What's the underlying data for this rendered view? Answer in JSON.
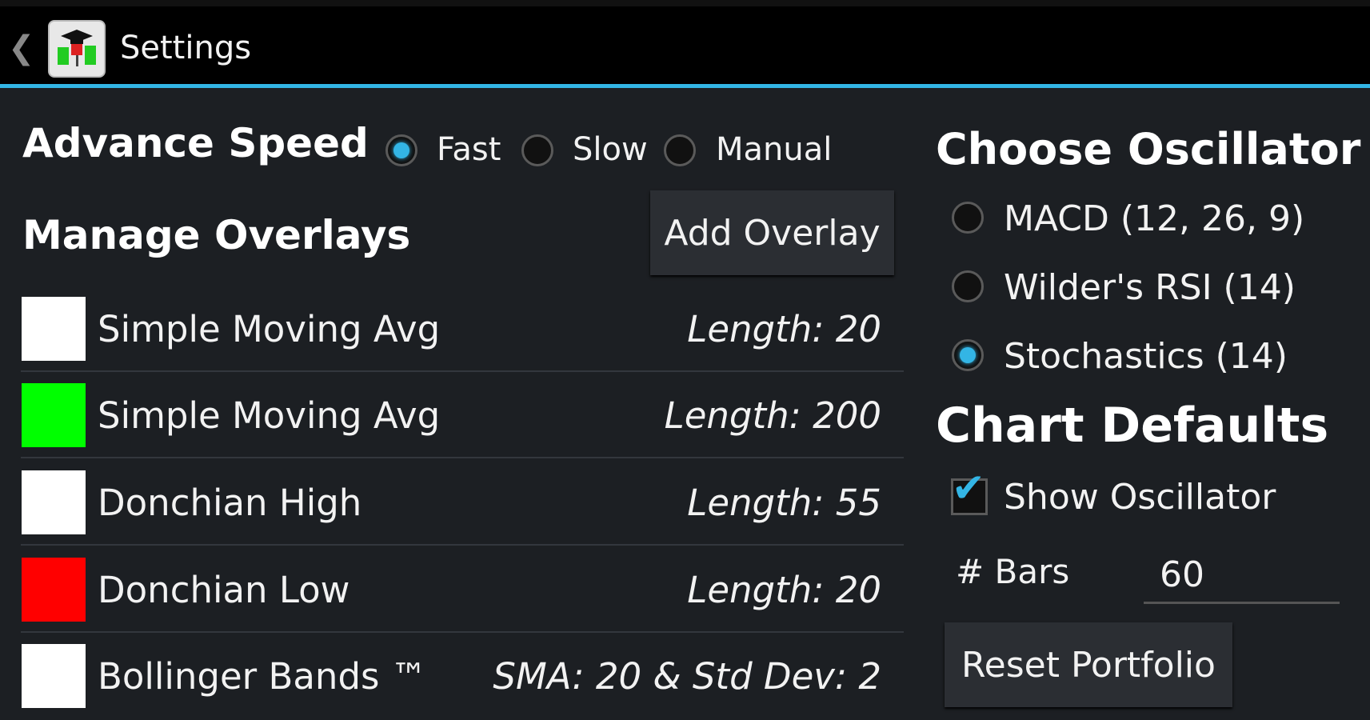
{
  "app_bar": {
    "title": "Settings",
    "back_icon": "chevron-left-icon",
    "app_icon": "candlestick-graduation-cap-icon"
  },
  "advance_speed": {
    "heading": "Advance Speed",
    "options": [
      {
        "label": "Fast",
        "checked": true
      },
      {
        "label": "Slow",
        "checked": false
      },
      {
        "label": "Manual",
        "checked": false
      }
    ]
  },
  "overlays": {
    "heading": "Manage Overlays",
    "add_button": "Add Overlay",
    "items": [
      {
        "name": "Simple Moving Avg",
        "param": "Length: 20",
        "color": "#ffffff"
      },
      {
        "name": "Simple Moving Avg",
        "param": "Length: 200",
        "color": "#00ff00"
      },
      {
        "name": "Donchian High",
        "param": "Length: 55",
        "color": "#ffffff"
      },
      {
        "name": "Donchian Low",
        "param": "Length: 20",
        "color": "#ff0000"
      },
      {
        "name": "Bollinger Bands ™",
        "param": "SMA: 20 & Std Dev: 2",
        "color": "#ffffff"
      }
    ]
  },
  "oscillator": {
    "heading": "Choose Oscillator",
    "options": [
      {
        "label": "MACD (12, 26, 9)",
        "checked": false
      },
      {
        "label": "Wilder's RSI (14)",
        "checked": false
      },
      {
        "label": "Stochastics (14)",
        "checked": true
      }
    ]
  },
  "chart_defaults": {
    "heading": "Chart Defaults",
    "show_oscillator_label": "Show Oscillator",
    "show_oscillator_checked": true,
    "bars_label": "# Bars",
    "bars_value": "60",
    "reset_button": "Reset Portfolio"
  },
  "colors": {
    "accent": "#33b5e5",
    "background": "#1c1f23",
    "action_bar": "#000000"
  }
}
